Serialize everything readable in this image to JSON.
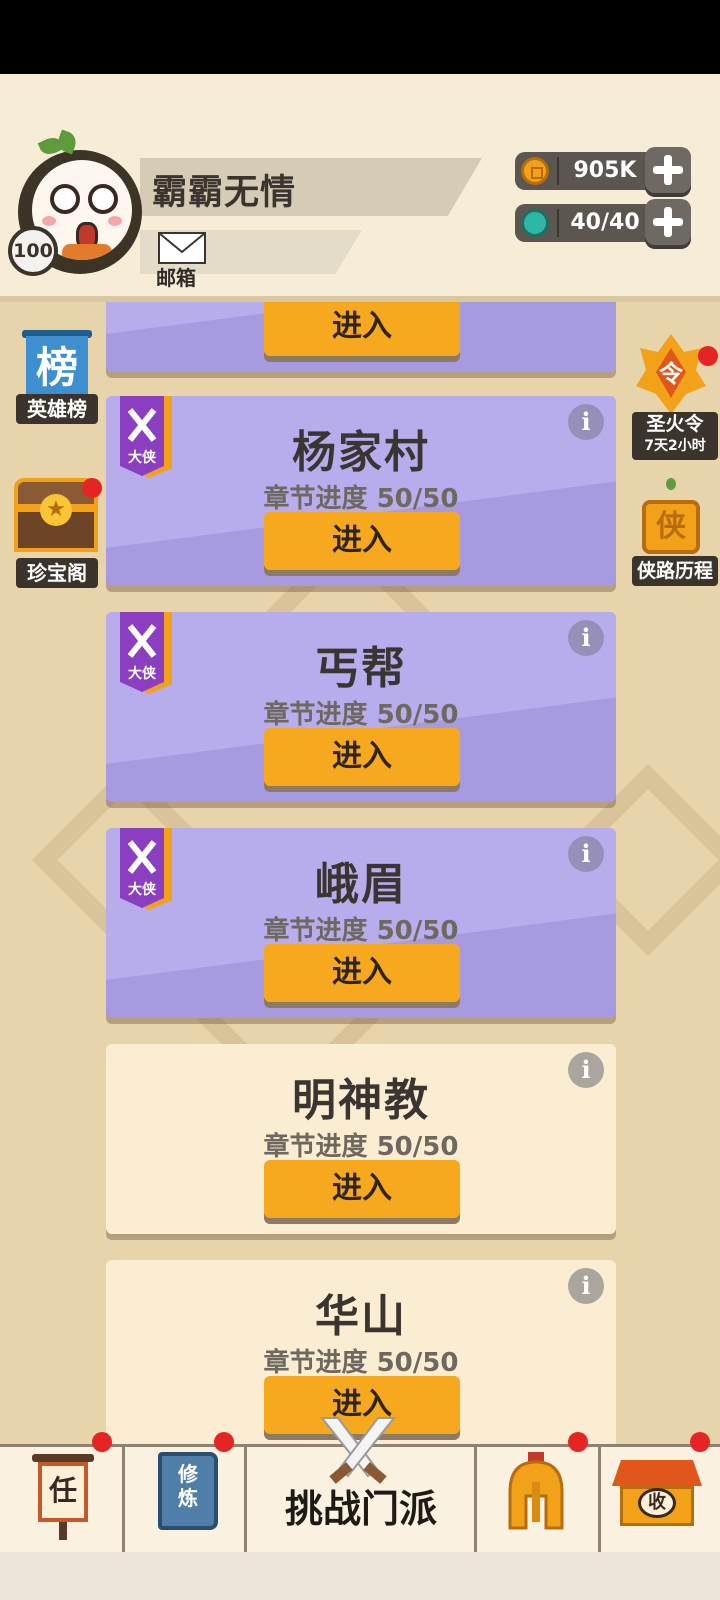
{
  "player": {
    "name": "霸霸无情",
    "level": "100",
    "mail_label": "邮箱"
  },
  "resources": [
    {
      "name": "coins",
      "value": "905K",
      "icon": "coin-icon",
      "color": "#f2a119"
    },
    {
      "name": "stamina",
      "value": "40/40",
      "icon": "stamina-orb-icon",
      "color": "#2fb7a6"
    }
  ],
  "left_menu": [
    {
      "label": "英雄榜",
      "icon_text": "榜",
      "icon": "scroll-banner-icon",
      "badge": false
    },
    {
      "label": "珍宝阁",
      "icon": "treasure-chest-icon",
      "badge": true
    }
  ],
  "right_menu": [
    {
      "label": "圣火令",
      "icon_text": "令",
      "sub": "7天2小时",
      "icon": "flame-token-icon",
      "badge": true
    },
    {
      "label": "侠路历程",
      "icon_text": "侠",
      "icon": "lantern-icon",
      "badge": false
    }
  ],
  "sects": [
    {
      "title": "",
      "progress": "",
      "enter_label": "进入",
      "style": "purple",
      "rank": ""
    },
    {
      "title": "杨家村",
      "progress": "章节进度 50/50",
      "enter_label": "进入",
      "style": "purple",
      "rank": "大侠"
    },
    {
      "title": "丐帮",
      "progress": "章节进度 50/50",
      "enter_label": "进入",
      "style": "purple",
      "rank": "大侠"
    },
    {
      "title": "峨眉",
      "progress": "章节进度 50/50",
      "enter_label": "进入",
      "style": "purple",
      "rank": "大侠"
    },
    {
      "title": "明神教",
      "progress": "章节进度 50/50",
      "enter_label": "进入",
      "style": "cream",
      "rank": ""
    },
    {
      "title": "华山",
      "progress": "章节进度 50/50",
      "enter_label": "进入",
      "style": "cream",
      "rank": ""
    }
  ],
  "info_glyph": "i",
  "bottom_nav": [
    {
      "name": "tasks",
      "icon_text": "任",
      "icon": "task-scroll-icon",
      "badge": true
    },
    {
      "name": "training",
      "icon_text": "修炼",
      "icon": "training-book-icon",
      "badge": true
    },
    {
      "name": "challenge",
      "label": "挑战门派",
      "icon": "crossed-swords-icon",
      "badge": false
    },
    {
      "name": "equipment",
      "icon": "helmet-icon",
      "badge": true
    },
    {
      "name": "collect",
      "icon_text": "收",
      "icon": "pavilion-icon",
      "badge": true
    }
  ]
}
